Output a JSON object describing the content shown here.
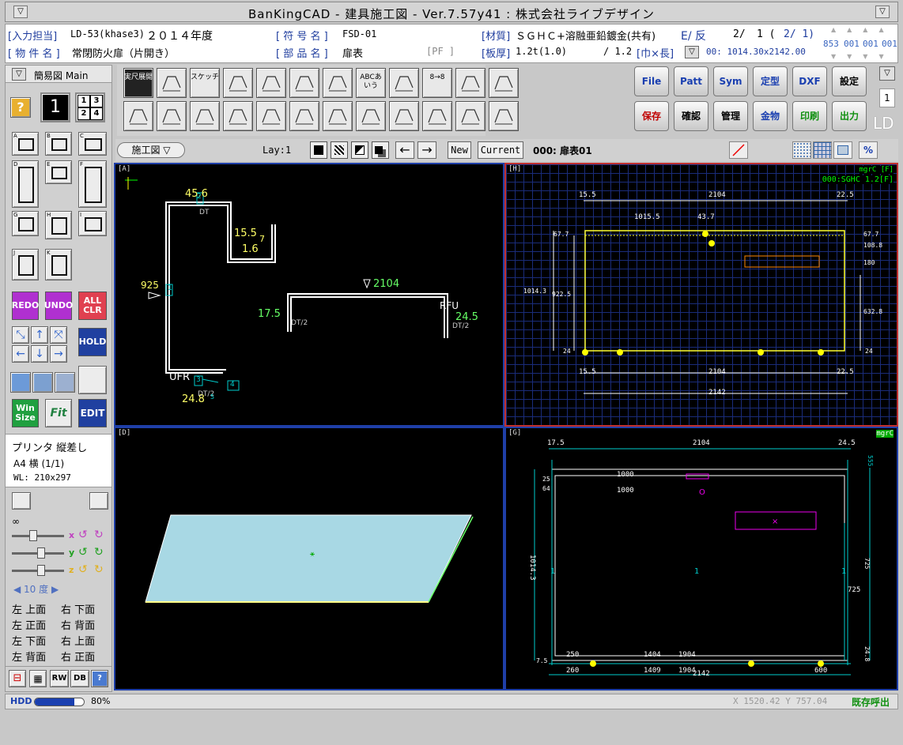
{
  "window": {
    "title": "BanKingCAD - 建具施工図 - Ver.7.57y41 : 株式会社ライブデザイン"
  },
  "info": {
    "input_label": "[入力担当]",
    "input_value": "LD-53(khase3)",
    "year": "２０１４年度",
    "symbol_label": "[ 符 号 名 ]",
    "symbol_value": "FSD-01",
    "material_label": "[材質]",
    "material_value": "ＳＧＨＣ+溶融亜鉛鍍金(共有)",
    "face": "E/ 反",
    "page_a": "2/",
    "page_b": "1 (",
    "page_c": "2/ 1)",
    "property_label": "[ 物 件 名 ]",
    "property_value": "常閉防火扉（片開き）",
    "part_label": "[ 部 品 名 ]",
    "part_value": "扉表",
    "pf": "[PF ]",
    "thickness_label": "[板厚]",
    "thickness_value": "1.2t(1.0)",
    "thickness_2": "/ 1.2",
    "size_label": "[巾×長]",
    "size_value": "00: 1014.30x2142.00",
    "counters": [
      "853",
      "001",
      "001",
      "001"
    ]
  },
  "cmd_buttons": [
    {
      "label": "File",
      "color": "#1a3fb0"
    },
    {
      "label": "Patt",
      "color": "#1a3fb0"
    },
    {
      "label": "Sym",
      "color": "#1a3fb0"
    },
    {
      "label": "定型",
      "color": "#1a3fb0"
    },
    {
      "label": "DXF",
      "color": "#1a3fb0"
    },
    {
      "label": "設定",
      "color": "#000000"
    },
    {
      "label": "保存",
      "color": "#c00000"
    },
    {
      "label": "確認",
      "color": "#000000"
    },
    {
      "label": "管理",
      "color": "#000000"
    },
    {
      "label": "金物",
      "color": "#1a3fb0"
    },
    {
      "label": "印刷",
      "color": "#109010"
    },
    {
      "label": "出力",
      "color": "#109010"
    }
  ],
  "tools": {
    "t1": "実尺展開",
    "t2": "スケッチ",
    "t3": "ABCあいう",
    "t4": "8→8"
  },
  "side_right": {
    "num": "1",
    "logo": "LD"
  },
  "toolbar2": {
    "view_select": "施工図 ▽",
    "layer": "Lay:1",
    "new_label": "New",
    "current_label": "Current",
    "current_value": "000: 扉表01"
  },
  "left": {
    "title": "簡易図 Main",
    "q_mark": "?",
    "num_one": "1",
    "quad": [
      "1",
      "3",
      "2",
      "4"
    ],
    "letters": [
      "A",
      "B",
      "C",
      "D",
      "E",
      "F",
      "G",
      "H",
      "I",
      "J",
      "K"
    ],
    "redo": "REDO",
    "undo": "UNDO",
    "allclr": "ALL CLR",
    "hold": "HOLD",
    "winsize": "Win Size",
    "edit": "EDIT",
    "printer": "プリンタ 縦差し",
    "paper": "A4 横 (1/1)",
    "wl": "WL: 210x297",
    "inf": "∞",
    "axes": [
      "x",
      "y",
      "z"
    ],
    "degree": "◀ 10 度 ▶",
    "views": [
      [
        "左 上面",
        "右 下面"
      ],
      [
        "左 正面",
        "右 背面"
      ],
      [
        "左 下面",
        "右 上面"
      ],
      [
        "左 背面",
        "右 正面"
      ]
    ],
    "bottom": [
      "RW",
      "DB"
    ]
  },
  "vpA": {
    "label": "[A]",
    "dims": {
      "d1": "45.6",
      "d2": "15.5",
      "d3": "1.6",
      "d4": "925",
      "d5": "2104",
      "d6": "17.5",
      "d7": "24.5",
      "d8": "24.8"
    },
    "tags": {
      "dt1": "DT",
      "ufr": "UFR",
      "dt2": "DT/2",
      "dt3": "DT/2",
      "dt4": "DT/2",
      "rfu": "RFU",
      "seven": "7",
      "b1": "1",
      "b2": "2",
      "b3": "3",
      "b4": "4",
      "b5": "5"
    }
  },
  "vpH": {
    "label": "[H]",
    "tag": "mgrC [F]",
    "sub": "000:SGHC 1.2[F]",
    "dims": {
      "top_l": "15.5",
      "top_c": "2104",
      "top_r": "22.5",
      "w1": "1015.5",
      "w2": "43.7",
      "l1": "67.7",
      "r1": "67.7",
      "r2": "108.8",
      "r3": "180",
      "h1": "1014.3",
      "h2": "922.5",
      "r4": "632.8",
      "b_l": "15.5",
      "b_c": "2104",
      "b_r": "22.5",
      "total": "2142",
      "s1": "24",
      "s2": "24"
    }
  },
  "vpD": {
    "label": "[D]"
  },
  "vpG": {
    "label": "[G]",
    "tag": "mgrC",
    "dims": {
      "t_l": "17.5",
      "t_c": "2104",
      "t_r": "24.5",
      "a1": "1000",
      "a2": "1000",
      "a3": "25",
      "a4": "64",
      "v1": "1014.3",
      "one1": "1",
      "one2": "1",
      "one3": "1",
      "r1": "725",
      "r2": "725",
      "rt": "555",
      "b1": "250",
      "b2": "1404",
      "b3": "1904",
      "b4": "260",
      "b5": "1409",
      "b6": "1904",
      "b7": "600",
      "total": "2142",
      "bs": "24.8",
      "bl": "7.5",
      "o": "O"
    }
  },
  "status": {
    "hdd": "HDD",
    "hdd_pct": "80%",
    "hdd_fill": 0.8,
    "coords": "X 1520.42 Y  757.04",
    "mode": "既存呼出"
  }
}
